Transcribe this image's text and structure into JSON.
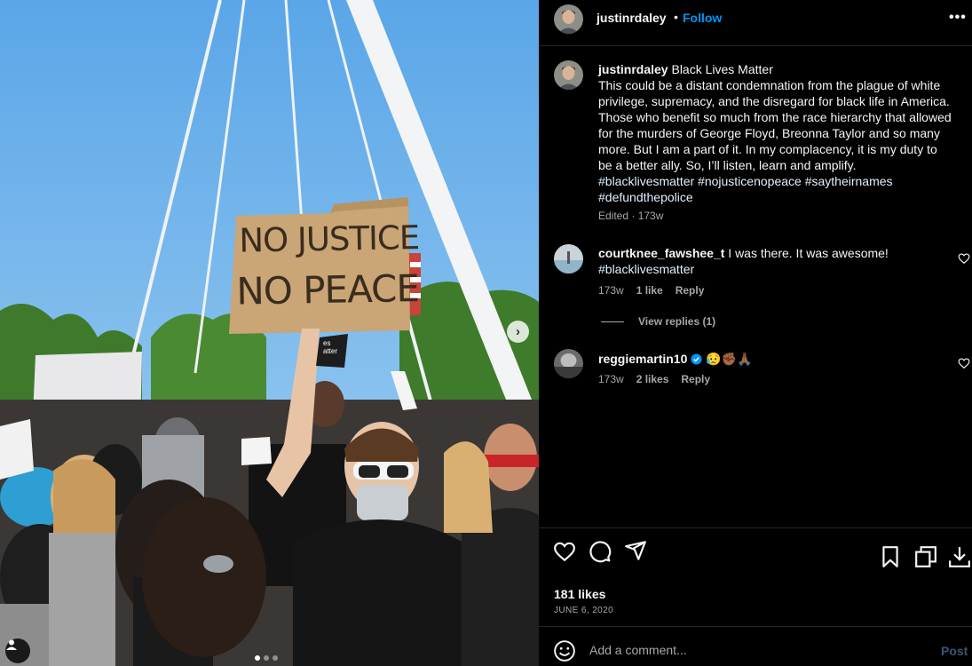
{
  "post": {
    "username": "justinrdaley",
    "follow_label": "Follow",
    "separator": "•",
    "more_label": "•••"
  },
  "caption": {
    "username": "justinrdaley",
    "text_intro": "Black Lives Matter",
    "text_body": "This could be a distant condemnation from the plague of white privilege, supremacy, and the disregard for black life in America. Those who benefit so much from the race hierarchy that allowed for the murders of George Floyd, Breonna Taylor and so many more. But I am a part of it. In my complacency, it is my duty to be a better ally. So, I’ll listen, learn and amplify.",
    "hashtags": [
      "#blacklivesmatter",
      "#nojusticenopeace",
      "#saytheirnames",
      "#defundthepolice"
    ],
    "meta": "Edited · 173w"
  },
  "comments": [
    {
      "username": "courtknee_fawshee_t",
      "text": "I was there. It was awesome!",
      "hashtag": "#blacklivesmatter",
      "age": "173w",
      "likes": "1 like",
      "reply_label": "Reply",
      "view_replies": "View replies (1)"
    },
    {
      "username": "reggiemartin10",
      "verified": true,
      "text": "😥✊🏾🙏🏾",
      "age": "173w",
      "likes": "2 likes",
      "reply_label": "Reply"
    }
  ],
  "stats": {
    "likes": "181 likes",
    "date": "JUNE 6, 2020"
  },
  "add_comment": {
    "placeholder": "Add a comment...",
    "post_label": "Post"
  },
  "photo": {
    "sign_line1": "NO JUSTICE",
    "sign_line2": "NO PEACE",
    "small_sign": "es atter",
    "next_label": "›",
    "carousel_count": 3,
    "carousel_active": 1
  },
  "icons": {
    "heart": "heart-icon",
    "comment": "comment-icon",
    "share": "share-icon",
    "save": "bookmark-icon",
    "collections": "collection-icon",
    "download": "download-icon",
    "emoji": "emoji-icon",
    "verified": "verified-badge-icon"
  },
  "colors": {
    "background": "#000000",
    "link_blue": "#0095f6",
    "muted": "#a8a8a8",
    "hashtag": "#e0f1ff"
  }
}
